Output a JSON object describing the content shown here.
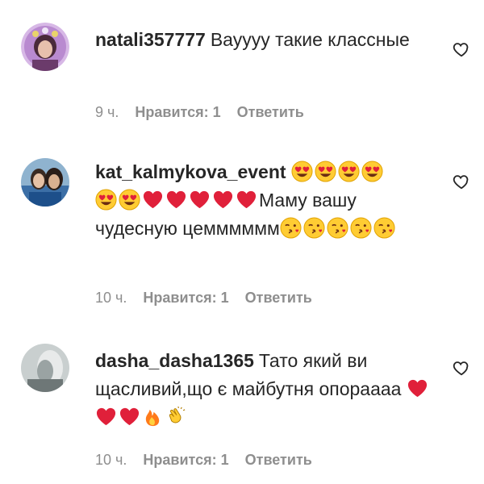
{
  "comments": [
    {
      "username": "natali357777",
      "text_1": "Вауууу такие классные",
      "time": "9 ч.",
      "likes": "Нравится: 1",
      "reply": "Ответить"
    },
    {
      "username": "kat_kalmykova_event",
      "text_1": "Маму вашу чудесную цемммммм",
      "emoji_1": [
        "heart-eyes-emoji",
        "heart-eyes-emoji",
        "heart-eyes-emoji",
        "heart-eyes-emoji",
        "heart-eyes-emoji",
        "heart-eyes-emoji",
        "red-heart-emoji",
        "red-heart-emoji",
        "red-heart-emoji",
        "red-heart-emoji",
        "red-heart-emoji"
      ],
      "emoji_2": [
        "kiss-emoji",
        "kiss-emoji",
        "kiss-emoji",
        "kiss-emoji",
        "kiss-emoji"
      ],
      "time": "10 ч.",
      "likes": "Нравится: 1",
      "reply": "Ответить"
    },
    {
      "username": "dasha_dasha1365",
      "text_1": "Тато який ви щасливий,що є майбутня опорааaa",
      "emoji_1": [
        "red-heart-emoji",
        "red-heart-emoji",
        "red-heart-emoji",
        "fire-emoji",
        "clapping-hands-emoji"
      ],
      "time": "10 ч.",
      "likes": "Нравится: 1",
      "reply": "Ответить"
    }
  ],
  "colors": {
    "text": "#262626",
    "meta": "#8e8e8e",
    "heart": "#e0203a",
    "emoji_face": "#ffcc33"
  }
}
